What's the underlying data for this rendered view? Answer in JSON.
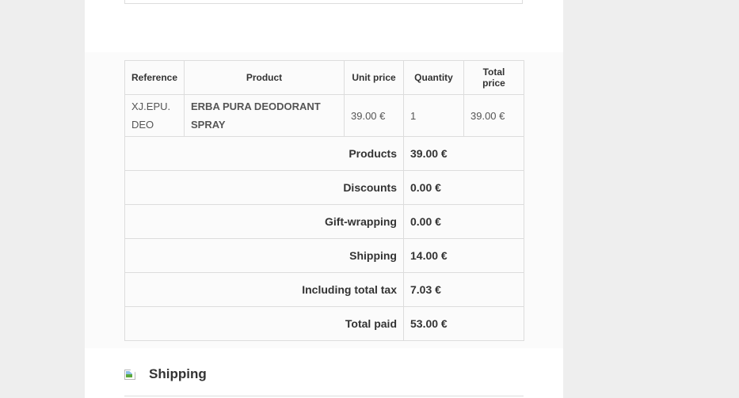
{
  "order_table": {
    "headers": [
      "Reference",
      "Product",
      "Unit price",
      "Quantity",
      "Total price"
    ],
    "items": [
      {
        "reference": "XJ.EPU.DEO",
        "product": "ERBA PURA DEODORANT SPRAY",
        "unit_price": "39.00 €",
        "quantity": "1",
        "total_price": "39.00 €"
      }
    ],
    "summary": [
      {
        "label": "Products",
        "value": "39.00 €"
      },
      {
        "label": "Discounts",
        "value": "0.00 €"
      },
      {
        "label": "Gift-wrapping",
        "value": "0.00 €"
      },
      {
        "label": "Shipping",
        "value": "14.00 €"
      },
      {
        "label": "Including total tax",
        "value": "7.03 €"
      },
      {
        "label": "Total paid",
        "value": "53.00 €"
      }
    ]
  },
  "shipping_section": {
    "title": "Shipping",
    "icon": "broken-image-icon"
  },
  "colors": {
    "page_background": "#eeeeee",
    "content_background": "#ffffff",
    "table_background": "#fbfbfb",
    "border": "#dddddd",
    "text": "#333333"
  }
}
